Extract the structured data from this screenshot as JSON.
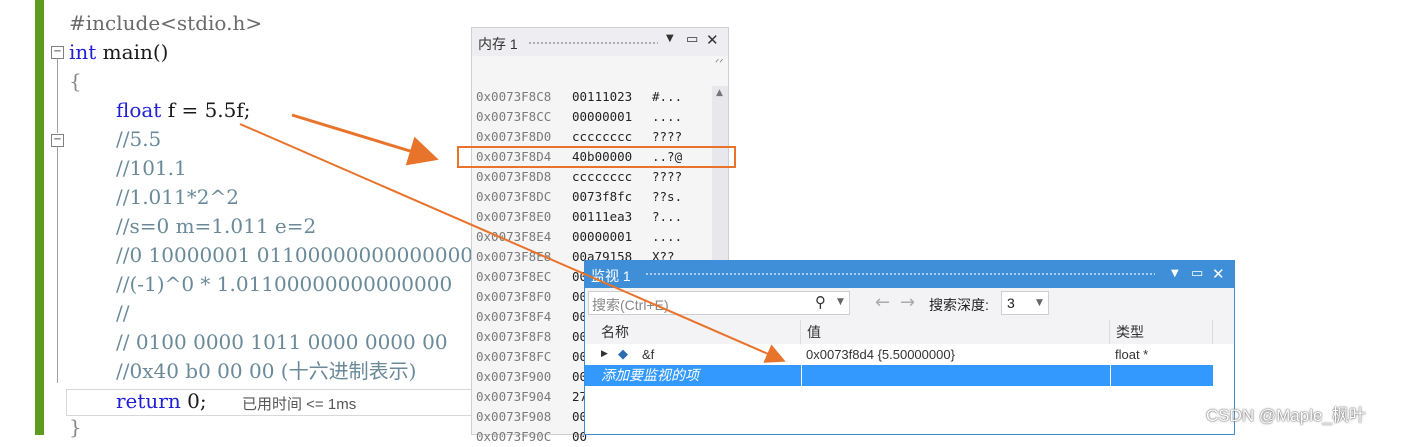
{
  "editor": {
    "lines": {
      "include": "#include<stdio.h>",
      "main_kw": "int",
      "main_rest": " main()",
      "open_brace": "{",
      "float_kw": "float",
      "float_rest": " f = 5.5f;",
      "c1": "//5.5",
      "c2": "//101.1",
      "c3": "//1.011*2^2",
      "c4": "//s=0 m=1.011 e=2",
      "c5": "//0 10000001 01100000000000000",
      "c6": "//(-1)^0 * 1.01100000000000000",
      "c7": "//",
      "c8": "// 0100 0000 1011 0000 0000 00",
      "c9": "//0x40 b0 00 00 (十六进制表示)",
      "return_kw": "return",
      "return_rest": " 0;",
      "close_brace": "}"
    },
    "elapsed_hint": "已用时间 <= 1ms"
  },
  "memory_window": {
    "title": "内存 1",
    "rows": [
      {
        "addr": "0x0073F8C8",
        "hex": "00111023",
        "ascii": "#..."
      },
      {
        "addr": "0x0073F8CC",
        "hex": "00000001",
        "ascii": "...."
      },
      {
        "addr": "0x0073F8D0",
        "hex": "cccccccc",
        "ascii": "????"
      },
      {
        "addr": "0x0073F8D4",
        "hex": "40b00000",
        "ascii": "..?@"
      },
      {
        "addr": "0x0073F8D8",
        "hex": "cccccccc",
        "ascii": "????"
      },
      {
        "addr": "0x0073F8DC",
        "hex": "0073f8fc",
        "ascii": "??s."
      },
      {
        "addr": "0x0073F8E0",
        "hex": "00111ea3",
        "ascii": "?..."
      },
      {
        "addr": "0x0073F8E4",
        "hex": "00000001",
        "ascii": "...."
      },
      {
        "addr": "0x0073F8E8",
        "hex": "00a79158",
        "ascii": "X??"
      },
      {
        "addr": "0x0073F8EC",
        "hex": "00",
        "ascii": ""
      },
      {
        "addr": "0x0073F8F0",
        "hex": "00",
        "ascii": ""
      },
      {
        "addr": "0x0073F8F4",
        "hex": "00",
        "ascii": ""
      },
      {
        "addr": "0x0073F8F8",
        "hex": "00",
        "ascii": ""
      },
      {
        "addr": "0x0073F8FC",
        "hex": "00",
        "ascii": ""
      },
      {
        "addr": "0x0073F900",
        "hex": "00",
        "ascii": ""
      },
      {
        "addr": "0x0073F904",
        "hex": "27",
        "ascii": ""
      },
      {
        "addr": "0x0073F908",
        "hex": "00",
        "ascii": ""
      },
      {
        "addr": "0x0073F90C",
        "hex": "00",
        "ascii": ""
      }
    ]
  },
  "watch_window": {
    "title": "监视 1",
    "search_placeholder": "搜索(Ctrl+E)",
    "depth_label": "搜索深度:",
    "depth_value": "3",
    "columns": {
      "name": "名称",
      "value": "值",
      "type": "类型"
    },
    "rows": [
      {
        "name": "&f",
        "value": "0x0073f8d4 {5.50000000}",
        "type": "float *"
      }
    ],
    "add_item": "添加要监视的项"
  },
  "watermark": "CSDN @Maple_枫叶",
  "colors": {
    "accent": "#3f8fd8",
    "highlight": "#e8732a",
    "gutter": "#5d9b1d",
    "selection": "#3399ff"
  }
}
